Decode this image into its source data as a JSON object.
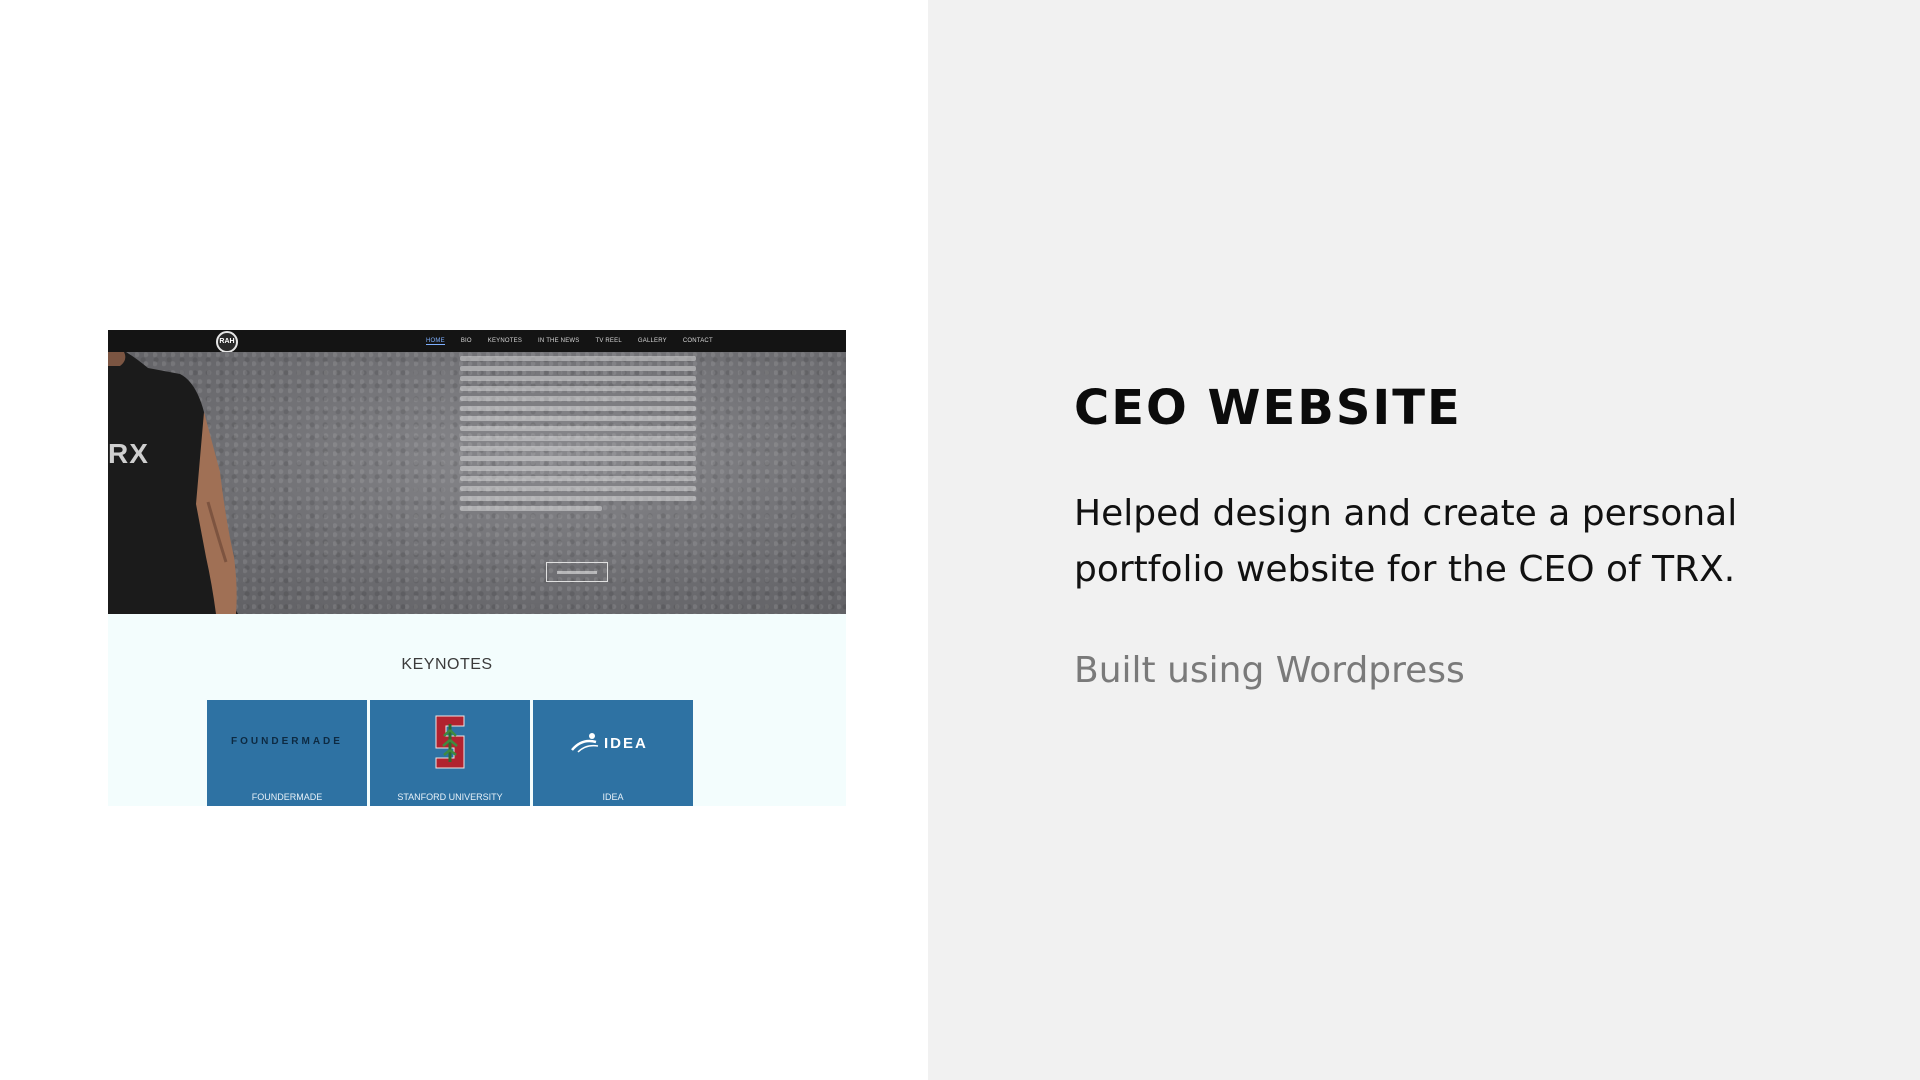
{
  "slide": {
    "title": "CEO WEBSITE",
    "description": "Helped design and create a personal portfolio website for the CEO of TRX.",
    "built_with": "Built using Wordpress"
  },
  "screenshot": {
    "nav": {
      "logo_text": "RAH",
      "items": [
        "HOME",
        "BIO",
        "KEYNOTES",
        "IN THE NEWS",
        "TV REEL",
        "GALLERY",
        "CONTACT"
      ],
      "active_item": "HOME"
    },
    "hero": {
      "shirt_text": "RX"
    },
    "keynotes": {
      "section_title": "KEYNOTES",
      "cards": [
        {
          "logo_text": "FOUNDERMADE",
          "caption": "FOUNDERMADE",
          "logo_icon": "foundermade-wordmark"
        },
        {
          "logo_text": "",
          "caption": "STANFORD UNIVERSITY",
          "logo_icon": "stanford-s-tree-icon"
        },
        {
          "logo_text": "IDEA",
          "caption": "IDEA",
          "logo_icon": "idea-swoosh-icon"
        }
      ]
    }
  },
  "colors": {
    "right_background": "#f1f1f1",
    "card_blue": "#2e72a3",
    "nav_dark": "#141414",
    "stanford_red": "#b1232f"
  }
}
